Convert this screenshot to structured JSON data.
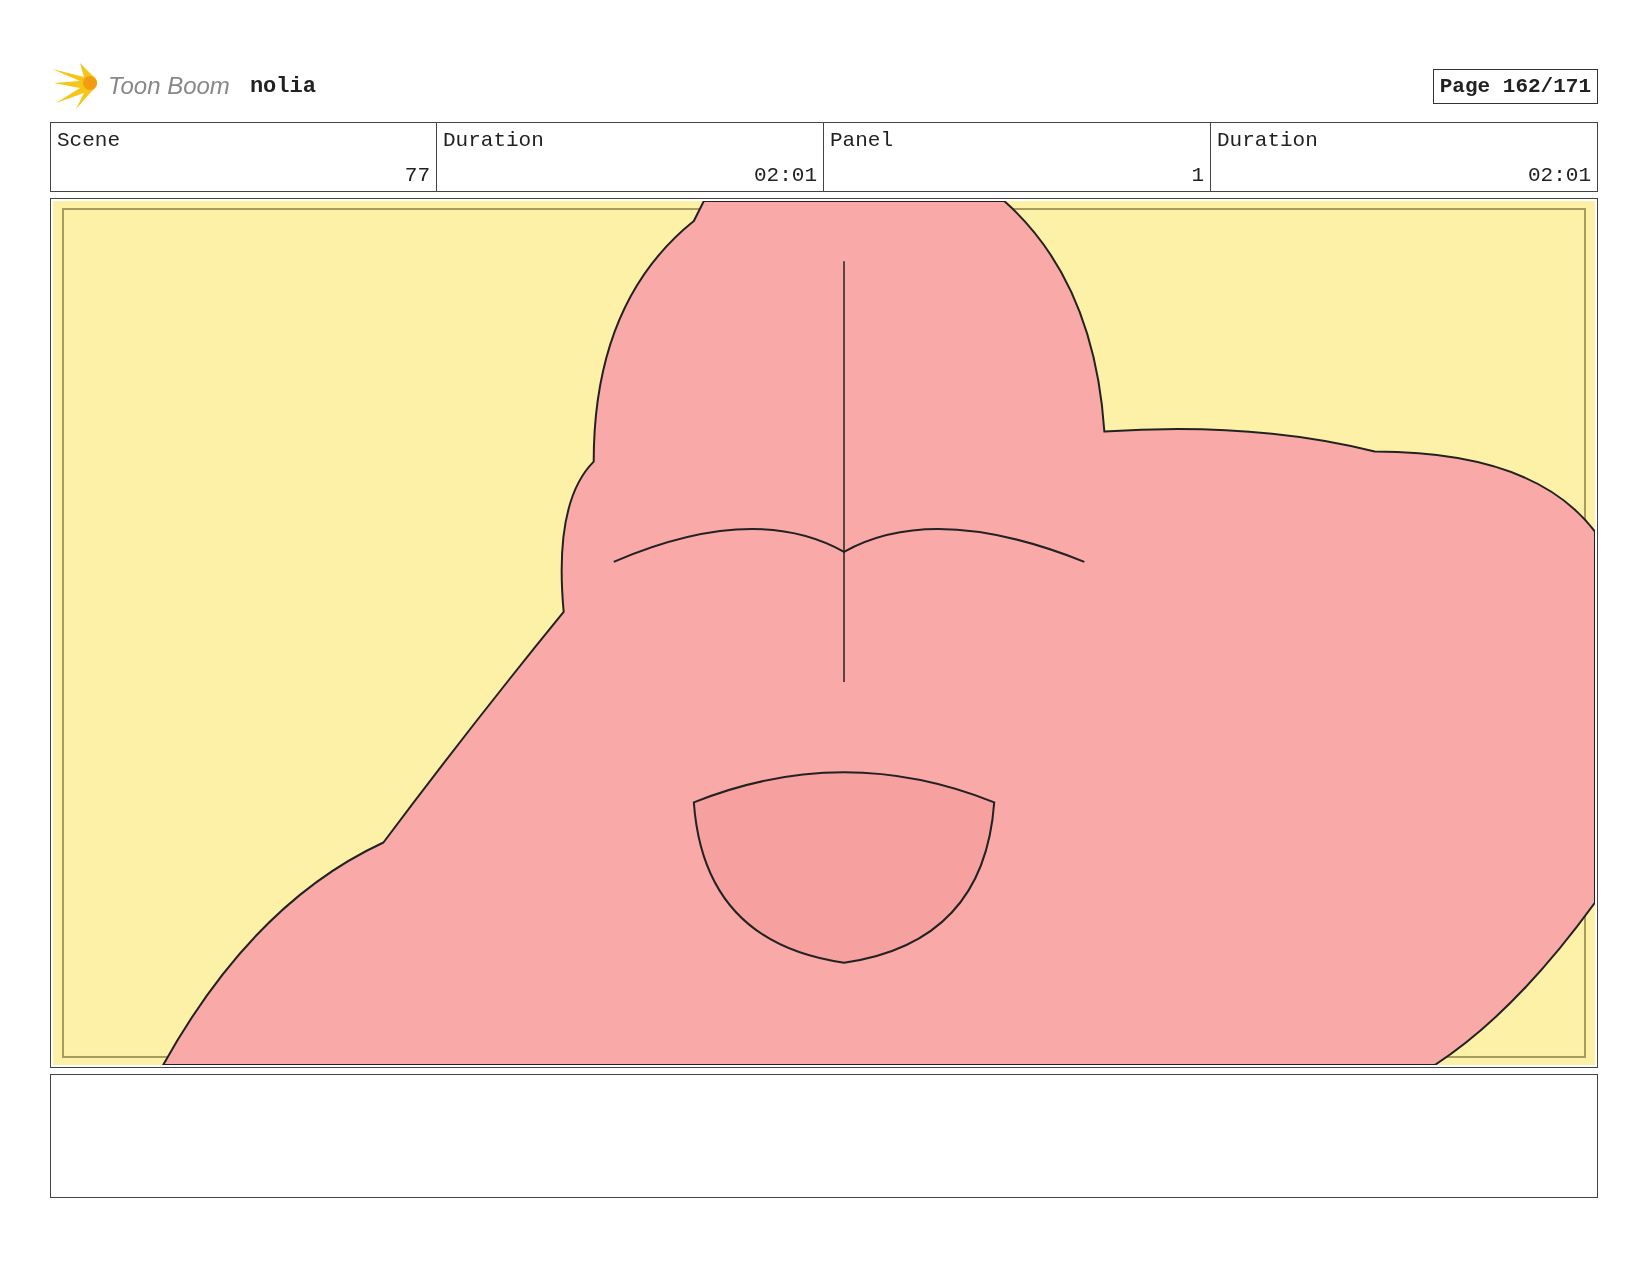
{
  "header": {
    "logo_text": "Toon Boom",
    "project": "nolia",
    "page": "Page 162/171"
  },
  "info_table": {
    "header_row": [
      "Scene",
      "Duration",
      "Panel",
      "Duration"
    ],
    "value_row": [
      "77",
      "02:01",
      "1",
      "02:01"
    ]
  }
}
